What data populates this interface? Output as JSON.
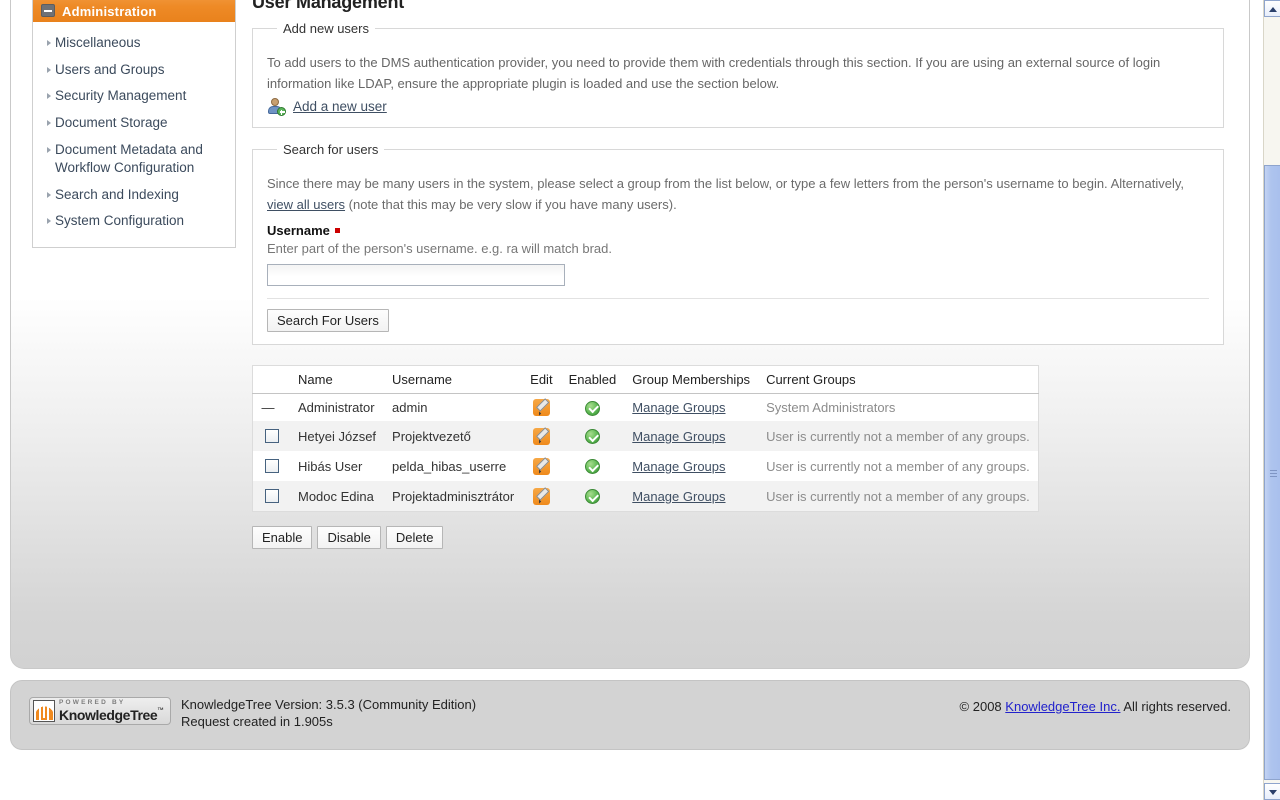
{
  "sidebar": {
    "header": "Administration",
    "items": [
      {
        "label": "Miscellaneous"
      },
      {
        "label": "Users and Groups"
      },
      {
        "label": "Security Management"
      },
      {
        "label": "Document Storage"
      },
      {
        "label": "Document Metadata and Workflow Configuration"
      },
      {
        "label": "Search and Indexing"
      },
      {
        "label": "System Configuration"
      }
    ]
  },
  "page": {
    "title": "User Management"
  },
  "add_users": {
    "legend": "Add new users",
    "description": "To add users to the DMS authentication provider, you need to provide them with credentials through this section. If you are using an external source of login information like LDAP, ensure the appropriate plugin is loaded and use the section below.",
    "add_link": "Add a new user"
  },
  "search_users": {
    "legend": "Search for users",
    "description_before": "Since there may be many users in the system, please select a group from the list below, or type a few letters from the person's username to begin. Alternatively,",
    "view_all_link": "view all users",
    "description_after": "(note that this may be very slow if you have many users).",
    "username_label": "Username",
    "username_hint": "Enter part of the person's username. e.g. ra will match brad.",
    "username_value": "",
    "username_placeholder": "",
    "search_button": "Search For Users"
  },
  "users_table": {
    "columns": [
      "",
      "Name",
      "Username",
      "Edit",
      "Enabled",
      "Group Memberships",
      "Current Groups"
    ],
    "manage_groups_label": "Manage Groups",
    "rows": [
      {
        "selectable": false,
        "name": "Administrator",
        "username": "admin",
        "enabled": true,
        "current_groups": "System Administrators"
      },
      {
        "selectable": true,
        "name": "Hetyei József",
        "username": "Projektvezető",
        "enabled": true,
        "current_groups": "User is currently not a member of any groups."
      },
      {
        "selectable": true,
        "name": "Hibás User",
        "username": "pelda_hibas_userre",
        "enabled": true,
        "current_groups": "User is currently not a member of any groups."
      },
      {
        "selectable": true,
        "name": "Modoc Edina",
        "username": "Projektadminisztrátor",
        "enabled": true,
        "current_groups": "User is currently not a member of any groups."
      }
    ]
  },
  "table_actions": {
    "enable": "Enable",
    "disable": "Disable",
    "delete": "Delete"
  },
  "footer": {
    "brand_powered_by": "POWERED BY",
    "brand_name": "KnowledgeTree",
    "brand_tm": "™",
    "version_line": "KnowledgeTree Version: 3.5.3 (Community Edition)",
    "request_line": "Request created in 1.905s",
    "copyright_prefix": "© 2008",
    "copyright_link": "KnowledgeTree Inc.",
    "copyright_suffix": "All rights reserved."
  },
  "colors": {
    "accent_orange": "#ee8a26",
    "link": "#3f4f63",
    "link_blue": "#2222cc",
    "required_red": "#cc0000",
    "enabled_green": "#57b44e"
  }
}
